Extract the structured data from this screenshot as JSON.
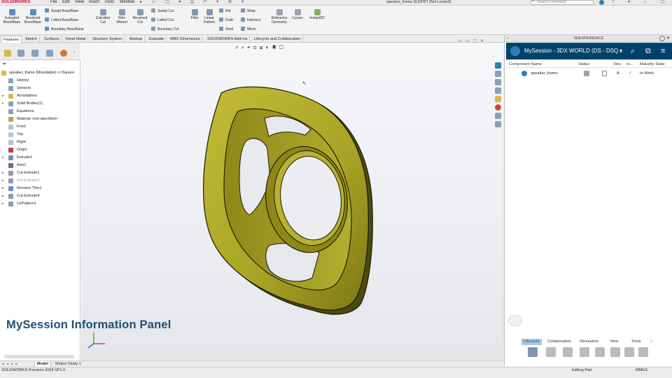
{
  "app": {
    "name": "SOLIDWORKS",
    "menus": [
      "File",
      "Edit",
      "View",
      "Insert",
      "Tools",
      "Window"
    ],
    "doc_title": "speaker_frame.SLDPRT [Not Locked]",
    "search_placeholder": "Search Commands"
  },
  "ribbon": {
    "big_buttons": [
      {
        "label": "Extruded Boss/Base",
        "icon": "extrude-boss-icon"
      },
      {
        "label": "Revolved Boss/Base",
        "icon": "revolve-boss-icon"
      },
      {
        "label": "Extruded Cut",
        "icon": "extrude-cut-icon"
      },
      {
        "label": "Hole Wizard",
        "icon": "hole-wizard-icon"
      },
      {
        "label": "Revolved Cut",
        "icon": "revolve-cut-icon"
      },
      {
        "label": "Fillet",
        "icon": "fillet-icon"
      },
      {
        "label": "Linear Pattern",
        "icon": "linear-pattern-icon"
      },
      {
        "label": "Reference Geometry",
        "icon": "reference-geometry-icon"
      },
      {
        "label": "Curves",
        "icon": "curves-icon"
      },
      {
        "label": "Instant3D",
        "icon": "instant3d-icon"
      }
    ],
    "small_buttons": [
      {
        "label": "Swept Boss/Base",
        "icon": "swept-boss-icon"
      },
      {
        "label": "Lofted Boss/Base",
        "icon": "lofted-boss-icon"
      },
      {
        "label": "Boundary Boss/Base",
        "icon": "boundary-boss-icon"
      },
      {
        "label": "Swept Cut",
        "icon": "swept-cut-icon"
      },
      {
        "label": "Lofted Cut",
        "icon": "lofted-cut-icon"
      },
      {
        "label": "Boundary Cut",
        "icon": "boundary-cut-icon"
      },
      {
        "label": "Rib",
        "icon": "rib-icon"
      },
      {
        "label": "Draft",
        "icon": "draft-icon"
      },
      {
        "label": "Shell",
        "icon": "shell-icon"
      },
      {
        "label": "Wrap",
        "icon": "wrap-icon"
      },
      {
        "label": "Intersect",
        "icon": "intersect-icon"
      },
      {
        "label": "Mirror",
        "icon": "mirror-icon"
      }
    ]
  },
  "command_tabs": [
    "Features",
    "Sketch",
    "Surfaces",
    "Sheet Metal",
    "Structure System",
    "Markup",
    "Evaluate",
    "MBD Dimensions",
    "SOLIDWORKS Add-Ins",
    "Lifecycle and Collaboration"
  ],
  "feature_tree": {
    "root": "speaker_frame (Mountable) <<Square",
    "items": [
      {
        "label": "History",
        "icon": "history-icon",
        "expand": ""
      },
      {
        "label": "Sensors",
        "icon": "sensors-icon",
        "expand": ""
      },
      {
        "label": "Annotations",
        "icon": "annotations-icon",
        "expand": "▸"
      },
      {
        "label": "Solid Bodies(1)",
        "icon": "solid-bodies-icon",
        "expand": "▸"
      },
      {
        "label": "Equations",
        "icon": "equations-icon",
        "expand": ""
      },
      {
        "label": "Material <not specified>",
        "icon": "material-icon",
        "expand": ""
      },
      {
        "label": "Front",
        "icon": "plane-icon",
        "expand": ""
      },
      {
        "label": "Top",
        "icon": "plane-icon",
        "expand": ""
      },
      {
        "label": "Right",
        "icon": "plane-icon",
        "expand": ""
      },
      {
        "label": "Origin",
        "icon": "origin-icon",
        "expand": ""
      },
      {
        "label": "Extrude1",
        "icon": "extrude-icon",
        "expand": "▸"
      },
      {
        "label": "Axis1",
        "icon": "axis-icon",
        "expand": ""
      },
      {
        "label": "Cut-Extrude1",
        "icon": "cut-extrude-icon",
        "expand": "▸"
      },
      {
        "label": "Cut-Extrude3",
        "icon": "cut-extrude-icon",
        "expand": "▸"
      },
      {
        "label": "Revolve-Thin1",
        "icon": "revolve-icon",
        "expand": "▸"
      },
      {
        "label": "Cut-Extrude4",
        "icon": "cut-extrude-icon",
        "expand": "▸"
      },
      {
        "label": "CirPattern1",
        "icon": "circular-pattern-icon",
        "expand": "▸"
      }
    ]
  },
  "overlay_caption": "MySession Information Panel",
  "bottom_tabs": [
    "Model",
    "Motion Study 1"
  ],
  "status": {
    "left": "SOLIDWORKS Premium 2024 SP1.0",
    "mode": "Editing Part",
    "units": "MMGS"
  },
  "task_pane": {
    "header": "3DEXPERIENCE",
    "session_title": "MySession - 3DX WORLD (DS - DSQ...",
    "columns": [
      "Component Name",
      "Status",
      "Rev",
      "Is...",
      "Maturity State"
    ],
    "rows": [
      {
        "name": "speaker_frame",
        "rev": "A",
        "maturity": "In Work"
      }
    ],
    "lower_tabs": [
      "Lifecycle",
      "Collaboration",
      "Simulation",
      "View",
      "Tools"
    ]
  },
  "colors": {
    "accent_blue": "#00426b",
    "part_color": "#a8a324",
    "caption_color": "#1f4f7a"
  }
}
